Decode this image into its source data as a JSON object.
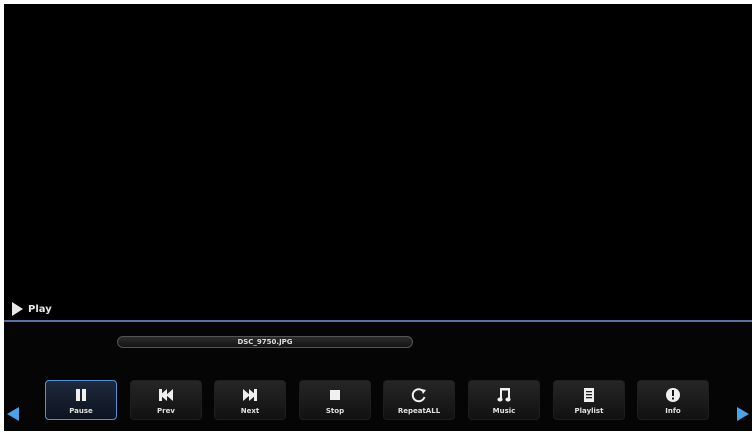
{
  "status": {
    "label": "Play",
    "icon": "play-icon"
  },
  "file": {
    "name": "DSC_9750.JPG"
  },
  "navigation": {
    "left_icon": "left-arrow-icon",
    "right_icon": "right-arrow-icon"
  },
  "colors": {
    "background": "#000000",
    "accent": "#4aa3e8",
    "divider": "#5a6fa8",
    "selected_border": "#5a8fd8"
  },
  "controls": [
    {
      "label": "Pause",
      "icon": "pause-icon",
      "selected": true
    },
    {
      "label": "Prev",
      "icon": "skip-previous-icon",
      "selected": false
    },
    {
      "label": "Next",
      "icon": "skip-next-icon",
      "selected": false
    },
    {
      "label": "Stop",
      "icon": "stop-icon",
      "selected": false
    },
    {
      "label": "RepeatALL",
      "icon": "repeat-icon",
      "selected": false
    },
    {
      "label": "Music",
      "icon": "music-note-icon",
      "selected": false
    },
    {
      "label": "Playlist",
      "icon": "playlist-icon",
      "selected": false
    },
    {
      "label": "Info",
      "icon": "info-icon",
      "selected": false
    }
  ]
}
